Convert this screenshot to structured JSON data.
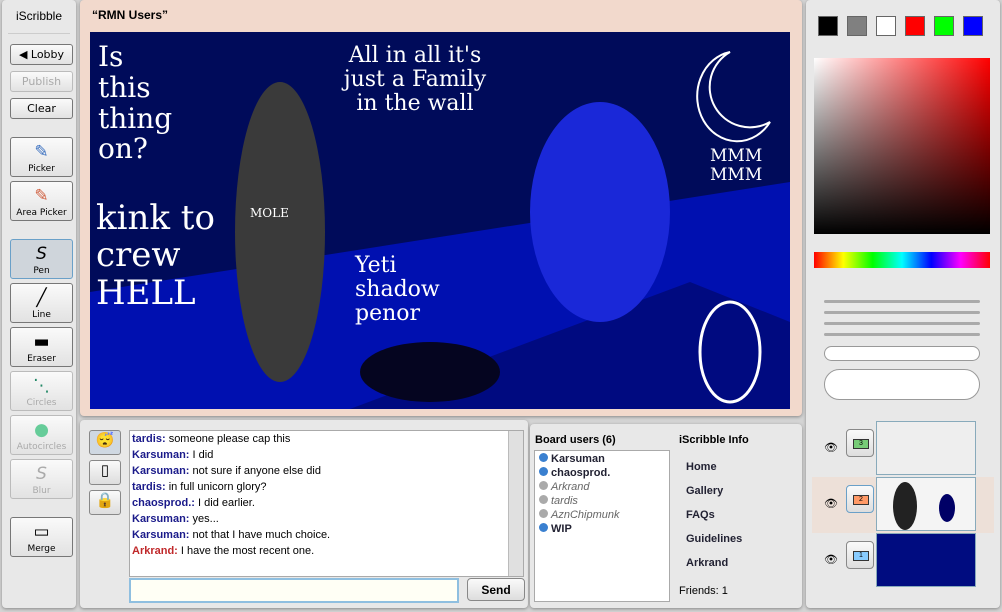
{
  "app": "iScribble",
  "toolbar": {
    "lobby": "◀ Lobby",
    "publish": "Publish",
    "clear": "Clear",
    "tools": [
      {
        "label": "Picker",
        "icon": "dropper-icon"
      },
      {
        "label": "Area Picker",
        "icon": "area-dropper-icon"
      },
      {
        "label": "Pen",
        "icon": "pen-icon"
      },
      {
        "label": "Line",
        "icon": "line-icon"
      },
      {
        "label": "Eraser",
        "icon": "eraser-icon"
      },
      {
        "label": "Circles",
        "icon": "circles-icon"
      },
      {
        "label": "Autocircles",
        "icon": "autocircles-icon"
      },
      {
        "label": "Blur",
        "icon": "blur-icon"
      },
      {
        "label": "Merge",
        "icon": "merge-icon"
      }
    ]
  },
  "board": {
    "title": "“RMN Users”",
    "drawing_text": [
      "Is this thing on?",
      "kink to crew HELL",
      "All in all it's just a Family in the wall",
      "Yeti shadow penor",
      "MOLE",
      "MMM MMM"
    ]
  },
  "chat": {
    "messages": [
      {
        "user": "tardis:",
        "text": "someone please cap this"
      },
      {
        "user": "Karsuman:",
        "text": "I did"
      },
      {
        "user": "Karsuman:",
        "text": "not sure if anyone else did"
      },
      {
        "user": "tardis:",
        "text": "in full unicorn glory?"
      },
      {
        "user": "chaosprod.:",
        "text": "I did earlier."
      },
      {
        "user": "Karsuman:",
        "text": "yes..."
      },
      {
        "user": "Karsuman:",
        "text": "not that I have much choice."
      },
      {
        "user": "Arkrand:",
        "text": "I have the most recent one."
      }
    ],
    "input": "",
    "send": "Send"
  },
  "users": {
    "title": "Board users (6)",
    "list": [
      "Karsuman",
      "chaosprod.",
      "Arkrand",
      "tardis",
      "AznChipmunk",
      "WIP"
    ]
  },
  "info": {
    "title": "iScribble Info",
    "links": [
      "Home",
      "Gallery",
      "FAQs",
      "Guidelines",
      "Arkrand"
    ],
    "friends": "Friends: 1"
  },
  "colors": [
    "#000000",
    "#808080",
    "#ffffff",
    "#ff0000",
    "#00ff00",
    "#0000ff"
  ],
  "layers": [
    "3",
    "2",
    "1"
  ]
}
